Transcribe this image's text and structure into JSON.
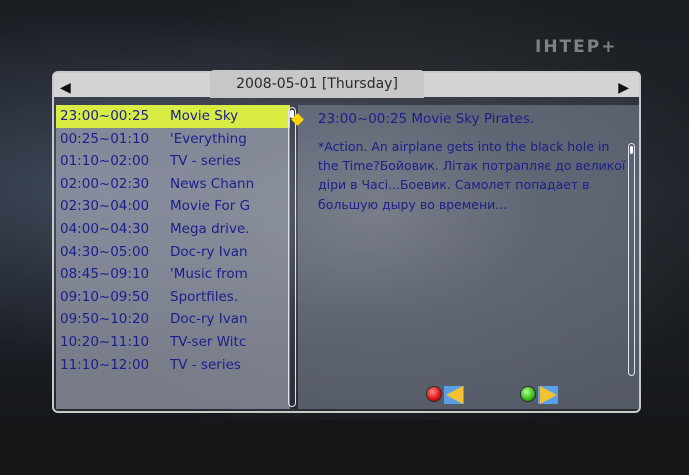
{
  "channel": {
    "logo_text": "ІНТЕР+"
  },
  "epg": {
    "date_label": "2008-05-01 [Thursday]",
    "nav_left": "◀",
    "nav_right": "▶",
    "schedule": [
      {
        "time": "23:00~00:25",
        "title": "Movie Sky",
        "selected": true
      },
      {
        "time": "00:25~01:10",
        "title": "'Everything"
      },
      {
        "time": "01:10~02:00",
        "title": "TV - series"
      },
      {
        "time": "02:00~02:30",
        "title": "News Chann"
      },
      {
        "time": "02:30~04:00",
        "title": "Movie For G"
      },
      {
        "time": "04:00~04:30",
        "title": "Mega drive."
      },
      {
        "time": "04:30~05:00",
        "title": "Doc-ry Ivan"
      },
      {
        "time": "08:45~09:10",
        "title": "'Music from"
      },
      {
        "time": "09:10~09:50",
        "title": "Sportfiles."
      },
      {
        "time": "09:50~10:20",
        "title": "Doc-ry Ivan"
      },
      {
        "time": "10:20~11:10",
        "title": "TV-ser Witc"
      },
      {
        "time": "11:10~12:00",
        "title": "TV - series"
      }
    ],
    "details": {
      "title": "23:00~00:25  Movie Sky Pirates.",
      "description": "*Action. An airplane gets into the black hole in the Time?Бойовик. Літак потрапляє до великої діри в Часі...Боевик. Самолет попадает в большую дыру во времени..."
    }
  },
  "colors": {
    "selected_row": "#d8ec44",
    "text": "#1a1f8c",
    "red_button": "#e01818",
    "green_button": "#3cc21c"
  }
}
